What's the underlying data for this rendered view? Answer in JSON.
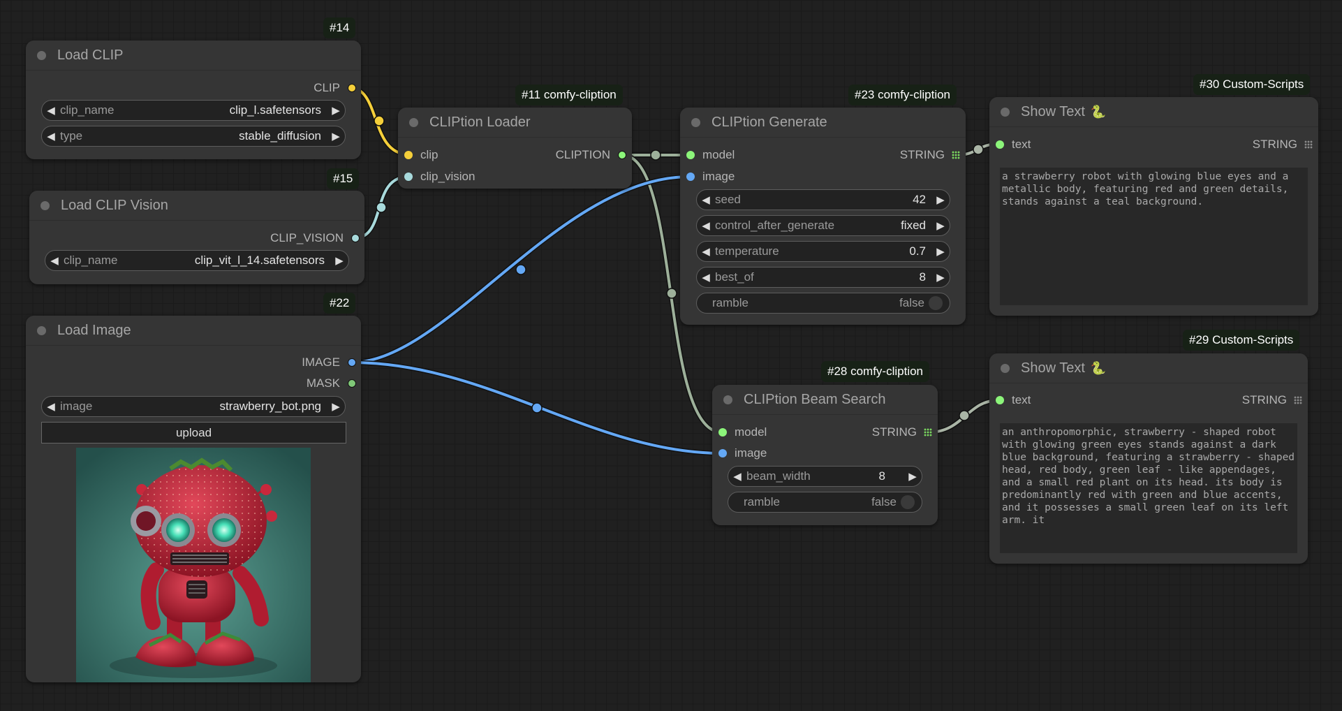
{
  "colors": {
    "clip": "#f5cf3a",
    "clip_vision": "#a8dadc",
    "image": "#64a8f5",
    "mask": "#80c878",
    "cliption": "#9db09a",
    "string_wire": "#aab5a6",
    "model_dot": "#8cf57a",
    "grid_icon": "#7ad85f",
    "grid_icon_dim": "#8a8a8a"
  },
  "nodes": {
    "load_clip": {
      "badge": "#14",
      "title": "Load CLIP",
      "output": "CLIP",
      "widgets": [
        {
          "label": "clip_name",
          "value": "clip_l.safetensors"
        },
        {
          "label": "type",
          "value": "stable_diffusion"
        }
      ]
    },
    "load_clip_vision": {
      "badge": "#15",
      "title": "Load CLIP Vision",
      "output": "CLIP_VISION",
      "widgets": [
        {
          "label": "clip_name",
          "value": "clip_vit_l_14.safetensors"
        }
      ]
    },
    "load_image": {
      "badge": "#22",
      "title": "Load Image",
      "outputs": [
        "IMAGE",
        "MASK"
      ],
      "widgets": [
        {
          "label": "image",
          "value": "strawberry_bot.png"
        }
      ],
      "upload_label": "upload",
      "preview_alt": "strawberry robot"
    },
    "cliption_loader": {
      "badge": "#11 comfy-cliption",
      "title": "CLIPtion Loader",
      "inputs": [
        "clip",
        "clip_vision"
      ],
      "output": "CLIPTION"
    },
    "cliption_generate": {
      "badge": "#23 comfy-cliption",
      "title": "CLIPtion Generate",
      "inputs": [
        "model",
        "image"
      ],
      "output": "STRING",
      "widgets": [
        {
          "label": "seed",
          "value": "42"
        },
        {
          "label": "control_after_generate",
          "value": "fixed"
        },
        {
          "label": "temperature",
          "value": "0.7"
        },
        {
          "label": "best_of",
          "value": "8"
        }
      ],
      "toggle": {
        "label": "ramble",
        "value": "false"
      }
    },
    "cliption_beam_search": {
      "badge": "#28 comfy-cliption",
      "title": "CLIPtion Beam Search",
      "inputs": [
        "model",
        "image"
      ],
      "output": "STRING",
      "widgets": [
        {
          "label": "beam_width",
          "value": "8"
        }
      ],
      "toggle": {
        "label": "ramble",
        "value": "false"
      }
    },
    "show_text_30": {
      "badge": "#30 Custom-Scripts",
      "title": "Show Text",
      "title_emoji": "🐍",
      "input": "text",
      "output": "STRING",
      "text": "a strawberry robot with glowing blue eyes and a metallic body, featuring red and green details, stands against a teal background."
    },
    "show_text_29": {
      "badge": "#29 Custom-Scripts",
      "title": "Show Text",
      "title_emoji": "🐍",
      "input": "text",
      "output": "STRING",
      "text": "an anthropomorphic, strawberry - shaped robot with glowing green eyes stands against a dark blue background, featuring a strawberry - shaped head, red body, green leaf - like appendages, and a small red plant on its head. its body is predominantly red with green and blue accents, and it possesses a small green leaf on its left arm. it"
    }
  },
  "arrows": {
    "left": "◀",
    "right": "▶"
  }
}
